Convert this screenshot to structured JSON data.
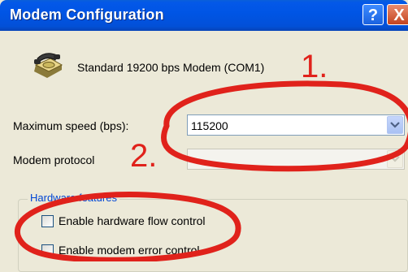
{
  "window": {
    "title": "Modem Configuration",
    "help_label": "?",
    "close_label": "X"
  },
  "modem": {
    "name": "Standard 19200 bps Modem (COM1)",
    "icon": "telephone-modem-icon"
  },
  "max_speed": {
    "label": "Maximum speed (bps):",
    "value": "115200"
  },
  "protocol": {
    "label": "Modem protocol",
    "value": ""
  },
  "hardware_features": {
    "legend": "Hardware features",
    "options": [
      {
        "label": "Enable hardware flow control",
        "checked": false
      },
      {
        "label": "Enable modem error control",
        "checked": false
      }
    ]
  },
  "annotations": {
    "step1": "1.",
    "step2": "2.",
    "color": "#e0221b"
  },
  "colors": {
    "titlebar": "#0055e5",
    "dialog_bg": "#ece9d8",
    "group_legend": "#0046d5"
  }
}
